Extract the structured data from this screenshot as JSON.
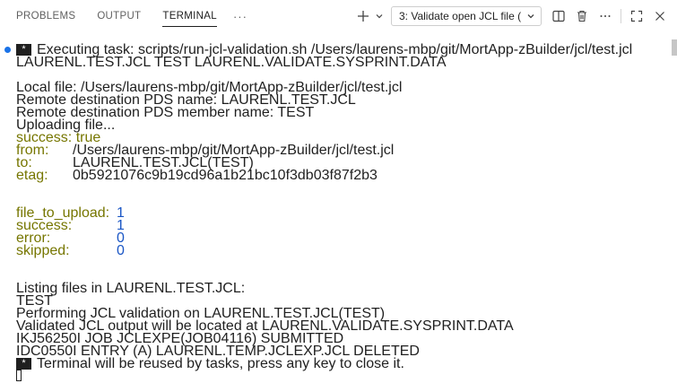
{
  "panel": {
    "tabs": [
      {
        "label": "PROBLEMS",
        "active": false
      },
      {
        "label": "OUTPUT",
        "active": false
      },
      {
        "label": "TERMINAL",
        "active": true
      }
    ],
    "more_tabs_glyph": "···",
    "terminal_select": "3: Validate open JCL file (",
    "icons": [
      "plus-icon",
      "chevron-down-icon",
      "split-icon",
      "trash-icon",
      "more-icon",
      "maximize-icon",
      "close-icon"
    ]
  },
  "terminal": {
    "task_marker": "*",
    "task_line": "Executing task: scripts/run-jcl-validation.sh /Users/laurens-mbp/git/MortApp-zBuilder/jcl/test.jcl",
    "task_line2": "LAURENL.TEST.JCL TEST LAURENL.VALIDATE.SYSPRINT.DATA",
    "local_file": "Local file: /Users/laurens-mbp/git/MortApp-zBuilder/jcl/test.jcl",
    "remote_pds": "Remote destination PDS name: LAURENL.TEST.JCL",
    "remote_member": "Remote destination PDS member name: TEST",
    "uploading": "Uploading file...",
    "upload": {
      "success_key": "success:",
      "success_val": "true",
      "from_key": "from:",
      "from_val": "/Users/laurens-mbp/git/MortApp-zBuilder/jcl/test.jcl",
      "to_key": "to:",
      "to_val": "LAURENL.TEST.JCL(TEST)",
      "etag_key": "etag:",
      "etag_val": "0b5921076c9b19cd96a1b21bc10f3db03f87f2b3"
    },
    "summary": {
      "file_to_upload_key": "file_to_upload:",
      "file_to_upload_val": "1",
      "success_key": "success:",
      "success_val": "1",
      "error_key": "error:",
      "error_val": "0",
      "skipped_key": "skipped:",
      "skipped_val": "0"
    },
    "listing": "Listing files in LAURENL.TEST.JCL:",
    "listing_item": "TEST",
    "performing": "Performing JCL validation on LAURENL.TEST.JCL(TEST)",
    "validated": "Validated JCL output will be located at LAURENL.VALIDATE.SYSPRINT.DATA",
    "ikj": "IKJ56250I JOB JCLEXPE(JOB04116) SUBMITTED",
    "idc": "IDC0550I ENTRY (A) LAURENL.TEMP.JCLEXP.JCL DELETED",
    "reuse_marker": "*",
    "reuse": "Terminal will be reused by tasks, press any key to close it."
  },
  "colors": {
    "key": "#767600",
    "number": "#1a56c5",
    "decoration_dot": "#1a73e8"
  }
}
